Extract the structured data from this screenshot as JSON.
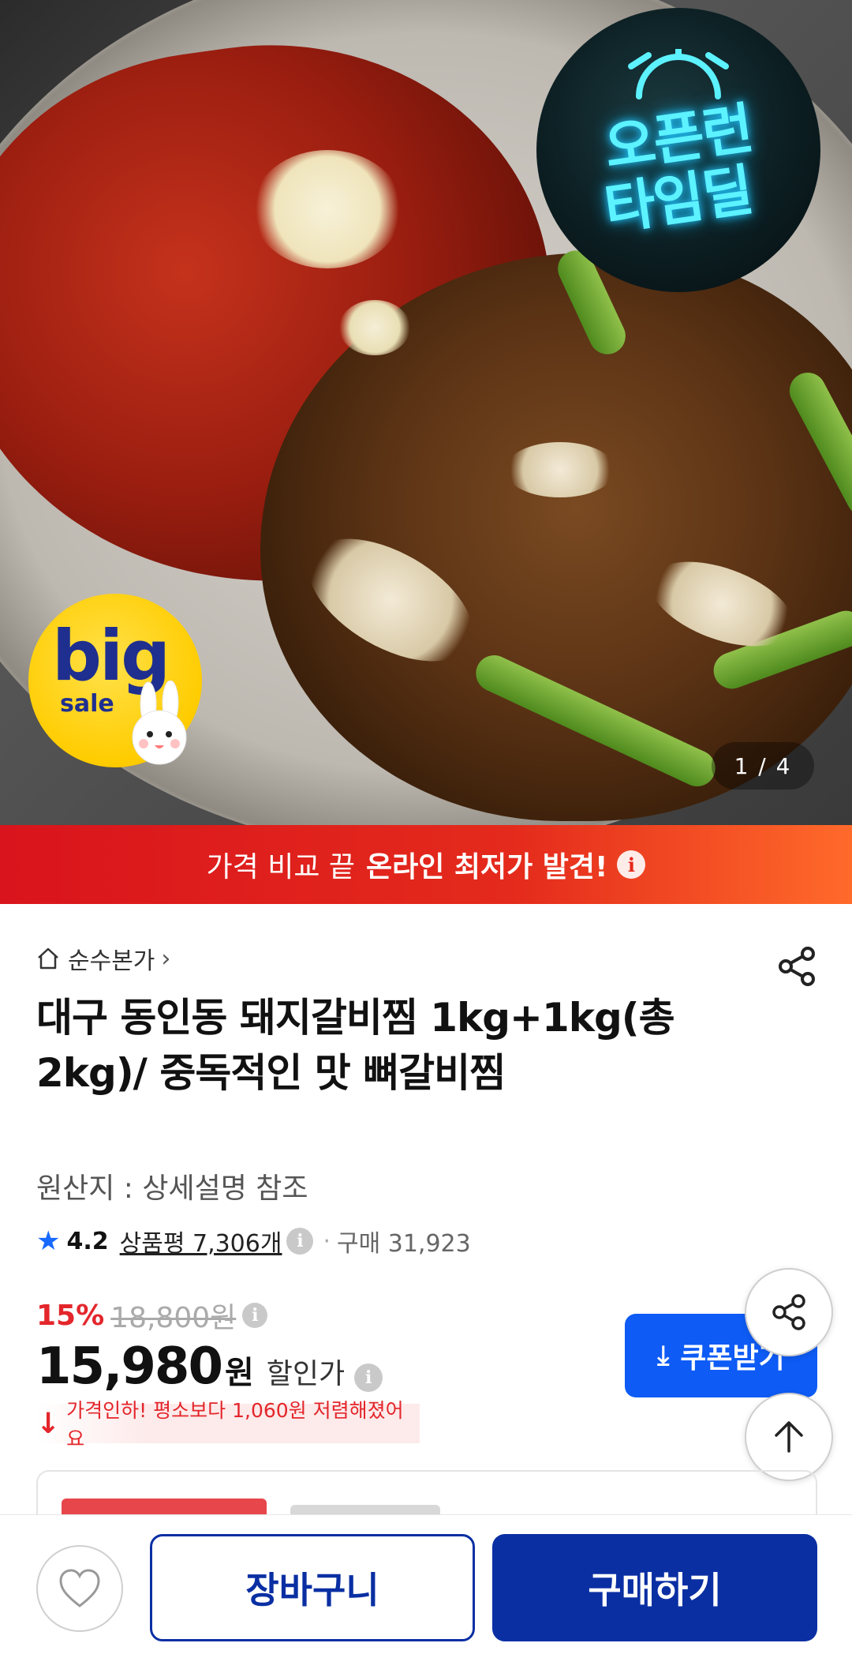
{
  "hero": {
    "badge_timedeal_line1": "오픈런",
    "badge_timedeal_line2": "타임딜",
    "badge_big": "big",
    "badge_sale": "sale",
    "image_counter": "1 / 4"
  },
  "price_banner": {
    "text": "가격 비교 끝",
    "highlight": "온라인 최저가 발견!",
    "info_icon": "i"
  },
  "product": {
    "store_name": "순수본가",
    "title": "대구 동인동 돼지갈비찜 1kg+1kg(총2kg)/ 중독적인 맛 뼈갈비찜",
    "origin": "원산지 : 상세설명 참조",
    "rating": "4.2",
    "reviews": "상품평 7,306개",
    "purchases": "구매 31,923",
    "discount_pct": "15%",
    "original_price": "18,800원",
    "price": "15,980",
    "price_unit": "원",
    "price_label": "할인가",
    "price_drop_text": "가격인하! 평소보다 1,060원 저렴해졌어요",
    "info_icon": "i"
  },
  "coupon": {
    "label": "쿠폰받기"
  },
  "bottom_bar": {
    "cart_label": "장바구니",
    "buy_label": "구매하기"
  },
  "colors": {
    "brand_blue": "#0a2fa3",
    "coupon_blue": "#0e5bf5",
    "discount_red": "#e3262b",
    "banner_red": "#d9141c"
  }
}
